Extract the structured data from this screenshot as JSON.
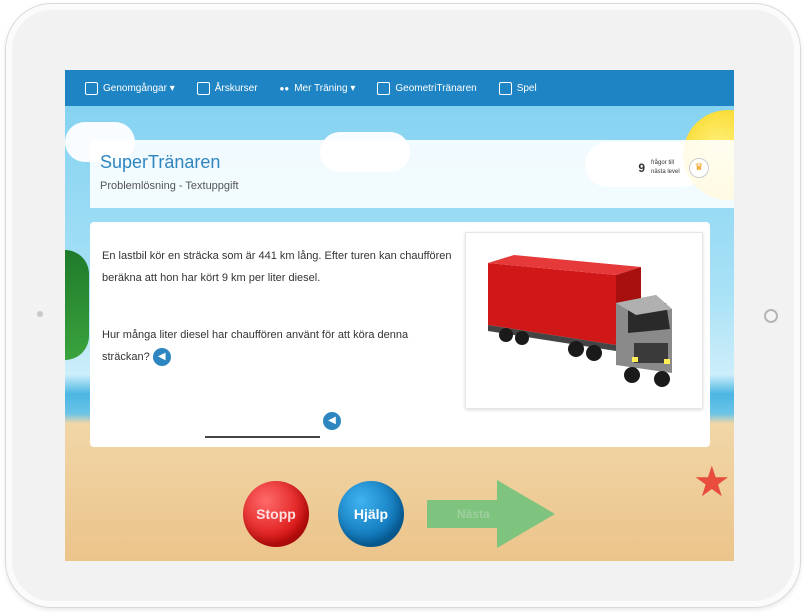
{
  "navbar": {
    "items": [
      {
        "label": "Genomgångar ▾",
        "icon": "video-icon"
      },
      {
        "label": "Årskurser",
        "icon": "book-icon"
      },
      {
        "label": "Mer Träning ▾",
        "icon": "dots-icon"
      },
      {
        "label": "GeometriTränaren",
        "icon": "geometry-icon"
      },
      {
        "label": "Spel",
        "icon": "gamepad-icon"
      }
    ]
  },
  "header": {
    "title": "SuperTränaren",
    "subtitle": "Problemlösning - Textuppgift",
    "progress_number": "9",
    "progress_text": "frågor till nästa level",
    "badge_icon": "medal-icon"
  },
  "problem": {
    "text": "En lastbil kör en sträcka som är 441 km lång. Efter turen kan chauffören beräkna att hon har kört 9 km per liter diesel.",
    "question": "Hur många liter diesel har chauffören använt för att köra denna sträckan?",
    "answer_value": "",
    "image": "truck-image"
  },
  "buttons": {
    "stop": "Stopp",
    "help": "Hjälp",
    "next": "Nästa"
  },
  "colors": {
    "navbar": "#1e84c4",
    "title": "#2e86c1",
    "stop": "#d90f0f",
    "help": "#0a6fb3",
    "next": "#7ec47e"
  }
}
